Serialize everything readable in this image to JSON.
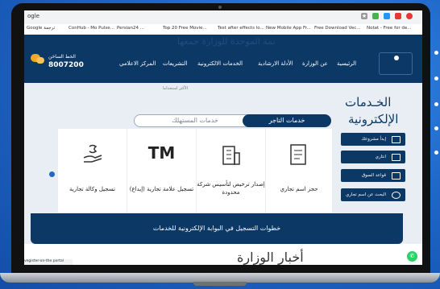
{
  "browser": {
    "url_prefix": "ogle",
    "bookmarks": [
      "Google ترجمة",
      "ConHub - Mo Pulse...",
      "Persian24 ...",
      "Top 20 Free Movie...",
      "Test after effects lo...",
      "New Mobile App Fr...",
      "Free Download Vec...",
      "Notat - Free for de..."
    ]
  },
  "site": {
    "watermark": "نمة الموحدة للوزارة جمعها",
    "hotline_label": "الخط الساخن",
    "hotline_number": "8007200",
    "nav": [
      "الرئيسية",
      "عن الوزارة",
      "الأدلة الارشادية",
      "الخدمات الالكترونية",
      "التشريعات",
      "المركز الاعلامي"
    ]
  },
  "services": {
    "top_label": "الأكثر استخداما",
    "title_line1": "الخـدمات",
    "title_line2": "الإلكترونية",
    "tab_merchant": "خدمات التاجر",
    "tab_consumer": "خدمات المستهلك",
    "side_buttons": [
      "إبدأ مشروعك",
      "انتاري",
      "قواعد السوق",
      "البحث عن اسم تجاري"
    ],
    "cards": [
      {
        "label": "حجز اسم تجاري",
        "icon": "document-icon"
      },
      {
        "label": "إصدار ترخيص لتأسيس شركة محدودة",
        "icon": "building-icon"
      },
      {
        "label": "تسجيل علامة تجارية (إيداع)",
        "icon": "trademark-icon",
        "glyph": "TM"
      },
      {
        "label": "تسجيل وكالة تجارية",
        "icon": "hand-coin-icon"
      }
    ],
    "banner": "خطوات التسجيل في البوابة الإلكترونية للخدمات"
  },
  "news": {
    "title": "أخبار الوزارة"
  },
  "status_text": "vegister-on-the portal",
  "colors": {
    "navy": "#0c3866",
    "background": "#1f68c9",
    "accent": "#f5a623"
  }
}
